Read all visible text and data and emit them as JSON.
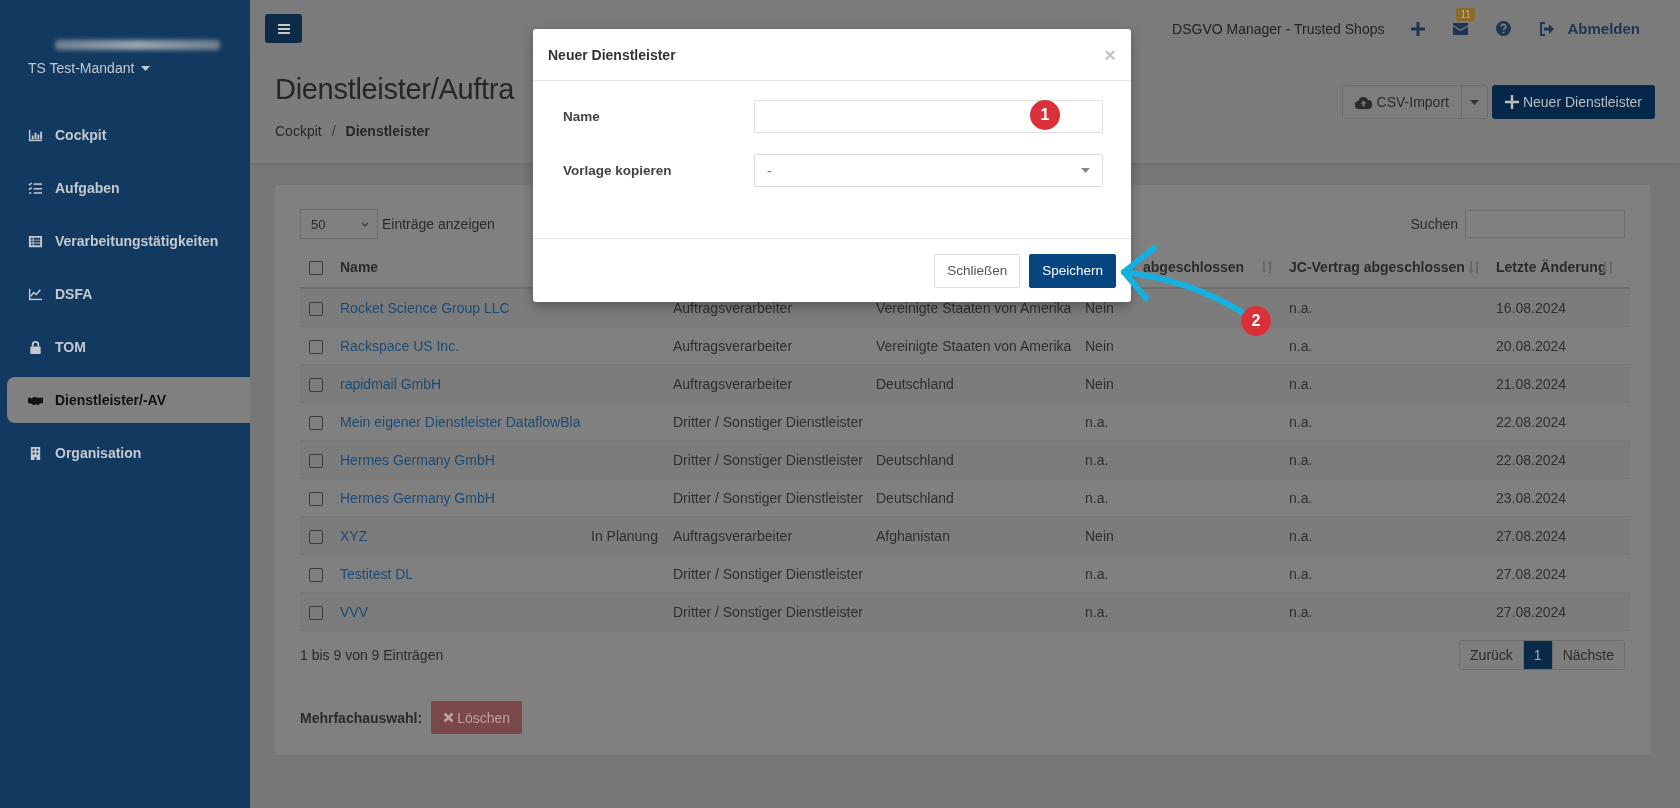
{
  "sidebar": {
    "tenant": "TS Test-Mandant",
    "items": [
      {
        "label": "Cockpit",
        "selected": false
      },
      {
        "label": "Aufgaben",
        "selected": false
      },
      {
        "label": "Verarbeitungstätigkeiten",
        "selected": false
      },
      {
        "label": "DSFA",
        "selected": false
      },
      {
        "label": "TOM",
        "selected": false
      },
      {
        "label": "Dienstleister/-AV",
        "selected": true
      },
      {
        "label": "Organisation",
        "selected": false
      }
    ]
  },
  "topbar": {
    "app_name": "DSGVO Manager - Trusted Shops",
    "mail_count": "11",
    "logout": "Abmelden"
  },
  "page": {
    "title": "Dienstleister/Auftra",
    "breadcrumb": [
      "Cockpit",
      "Dienstleister"
    ],
    "breadcrumb_separator": "/",
    "csv_import": "CSV-Import",
    "new_button": "Neuer Dienstleister"
  },
  "list": {
    "page_size": "50",
    "page_size_label": "Einträge anzeigen",
    "search_label": "Suchen",
    "select_all_checked": false,
    "header": {
      "name": "Name",
      "column_5": "abgeschlossen",
      "jc_contract": "JC-Vertrag abgeschlossen",
      "last_change": "Letzte Änderung"
    },
    "rows": [
      {
        "checked": false,
        "name": "Rocket Science Group LLC",
        "type": "Auftragsverarbeiter",
        "country": "Vereinigte Staaten von Amerika",
        "column_5": "Nein",
        "jc_contract": "n.a.",
        "last_change": "16.08.2024"
      },
      {
        "checked": false,
        "name": "Rackspace US Inc.",
        "type": "Auftragsverarbeiter",
        "country": "Vereinigte Staaten von Amerika",
        "column_5": "Nein",
        "jc_contract": "n.a.",
        "last_change": "20.08.2024"
      },
      {
        "checked": false,
        "name": "rapidmail GmbH",
        "type": "Auftragsverarbeiter",
        "country": "Deutschland",
        "column_5": "Nein",
        "jc_contract": "n.a.",
        "last_change": "21.08.2024"
      },
      {
        "checked": false,
        "name": "Mein eigener Dienstleister DataflowBla",
        "type": "Dritter / Sonstiger Dienstleister",
        "column_5": "n.a.",
        "jc_contract": "n.a.",
        "last_change": "22.08.2024"
      },
      {
        "checked": false,
        "name": "Hermes Germany GmbH",
        "type": "Dritter / Sonstiger Dienstleister",
        "country": "Deutschland",
        "column_5": "n.a.",
        "jc_contract": "n.a.",
        "last_change": "22.08.2024"
      },
      {
        "checked": false,
        "name": "Hermes Germany GmbH",
        "type": "Dritter / Sonstiger Dienstleister",
        "country": "Deutschland",
        "column_5": "n.a.",
        "jc_contract": "n.a.",
        "last_change": "23.08.2024"
      },
      {
        "checked": false,
        "name": "XYZ",
        "status": "In Planung",
        "type": "Auftragsverarbeiter",
        "country": "Afghanistan",
        "column_5": "Nein",
        "jc_contract": "n.a.",
        "last_change": "27.08.2024"
      },
      {
        "checked": false,
        "name": "Testitest DL",
        "type": "Dritter / Sonstiger Dienstleister",
        "column_5": "n.a.",
        "jc_contract": "n.a.",
        "last_change": "27.08.2024"
      },
      {
        "checked": false,
        "name": "VVV",
        "type": "Dritter / Sonstiger Dienstleister",
        "column_5": "n.a.",
        "jc_contract": "n.a.",
        "last_change": "27.08.2024"
      }
    ],
    "info": "1 bis 9 von 9 Einträgen",
    "pagination": [
      {
        "label": "Zurück",
        "selected": false
      },
      {
        "label": "1",
        "selected": true
      },
      {
        "label": "Nächste",
        "selected": false
      }
    ],
    "bulk_label": "Mehrfachauswahl:",
    "delete_button": "Löschen"
  },
  "modal": {
    "title": "Neuer Dienstleister",
    "close": "×",
    "fields": [
      {
        "label": "Name",
        "kind": "text"
      },
      {
        "label": "Vorlage kopieren",
        "kind": "select",
        "value": "-"
      }
    ],
    "buttons": [
      {
        "label": "Schließen",
        "kind": "secondary"
      },
      {
        "label": "Speichern",
        "kind": "primary"
      }
    ]
  },
  "annotations": [
    {
      "label": "1"
    },
    {
      "label": "2"
    }
  ]
}
